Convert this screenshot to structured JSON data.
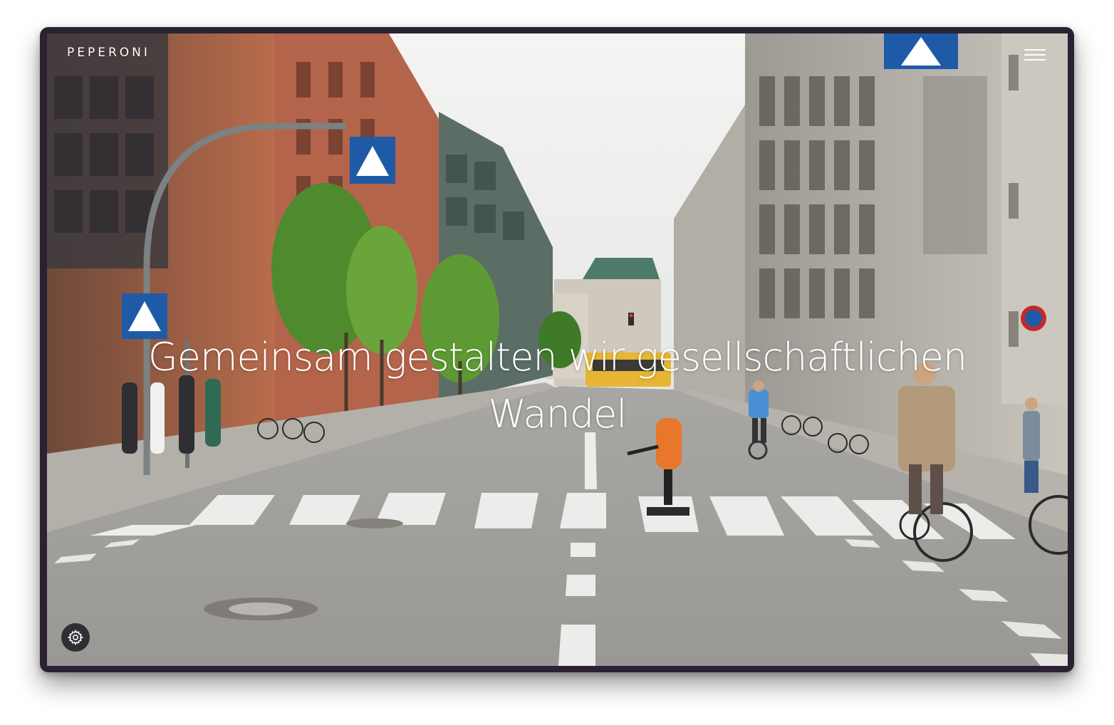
{
  "header": {
    "logo_text": "PEPERONI",
    "menu_icon": "hamburger-menu-icon"
  },
  "hero": {
    "headline": "Gemeinsam gestalten wir gesellschaftlichen Wandel"
  },
  "footer_controls": {
    "settings_icon": "gear-icon"
  },
  "colors": {
    "window_frame": "#2a2233",
    "text": "#ffffff",
    "settings_button_bg": "#2f2f33"
  }
}
